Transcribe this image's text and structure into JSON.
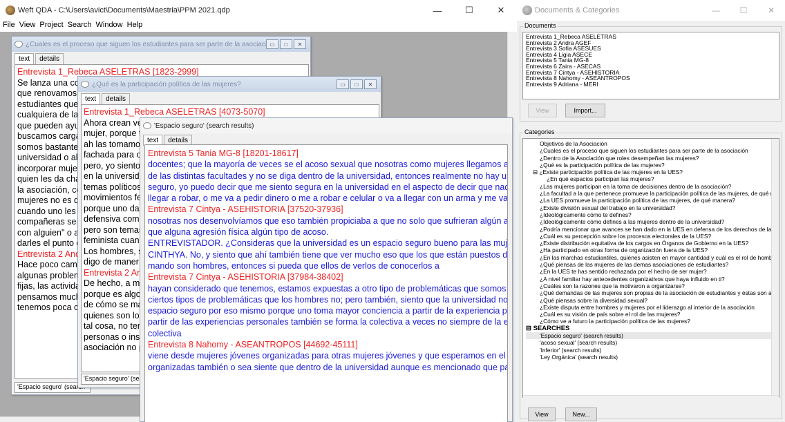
{
  "app": {
    "title": "Weft QDA - C:\\Users\\avict\\Documents\\Maestria\\PPM 2021.qdp",
    "menu": [
      "File",
      "View",
      "Project",
      "Search",
      "Window",
      "Help"
    ],
    "win_min": "—",
    "win_max": "☐",
    "win_close": "✕"
  },
  "windows": {
    "w1": {
      "title": "¿Cuales es el proceso que siguen los estudiantes para ser parte de la asociación",
      "tab_text": "text",
      "tab_details": "details",
      "lines": [
        {
          "c": "red",
          "t": "Entrevista 1_Rebeca ASELETRAS [1823-2999]"
        },
        {
          "c": "",
          "t": "Se lanza una co"
        },
        {
          "c": "",
          "t": "que renovamos"
        },
        {
          "c": "",
          "t": "estudiantes que"
        },
        {
          "c": "",
          "t": "cualquiera de las"
        },
        {
          "c": "",
          "t": "que pueden ayu"
        },
        {
          "c": "",
          "t": "buscamos carga"
        },
        {
          "c": "",
          "t": "somos bastante"
        },
        {
          "c": "",
          "t": "universidad o alg"
        },
        {
          "c": "",
          "t": "incorporar mujer"
        },
        {
          "c": "",
          "t": "quien les da cha"
        },
        {
          "c": "",
          "t": "la asociación, co"
        },
        {
          "c": "",
          "t": "mujeres no es q"
        },
        {
          "c": "",
          "t": "cuando uno les"
        },
        {
          "c": "",
          "t": "compañeras se"
        },
        {
          "c": "",
          "t": "con alguien\" o al"
        },
        {
          "c": "",
          "t": "darles el punto d"
        },
        {
          "c": "",
          "t": " "
        },
        {
          "c": "",
          "t": " "
        },
        {
          "c": "red",
          "t": "Entrevista 2 And"
        },
        {
          "c": "",
          "t": "Hace poco camb"
        },
        {
          "c": "",
          "t": "algunas problem"
        },
        {
          "c": "",
          "t": "fijas, las activida"
        },
        {
          "c": "",
          "t": "pensamos much"
        },
        {
          "c": "",
          "t": "tenemos poca c"
        }
      ],
      "status": "'Espacio seguro' (search"
    },
    "w2": {
      "title": "¿Qué es la participación política de las mujeres?",
      "tab_text": "text",
      "tab_details": "details",
      "lines": [
        {
          "c": "red",
          "t": "Entrevista 1_Rebeca ASELETRAS [4073-5070]"
        },
        {
          "c": "",
          "t": "Ahora crean ve"
        },
        {
          "c": "",
          "t": "mujer, porque t"
        },
        {
          "c": "",
          "t": "ah las tomamo"
        },
        {
          "c": "",
          "t": "fachada para c"
        },
        {
          "c": "",
          "t": "pero, yo siento"
        },
        {
          "c": "",
          "t": "en la universida"
        },
        {
          "c": "",
          "t": "temas políticos"
        },
        {
          "c": "",
          "t": "movimientos fe"
        },
        {
          "c": "",
          "t": "porque uno da"
        },
        {
          "c": "",
          "t": "defensiva com"
        },
        {
          "c": "",
          "t": "pero son temas"
        },
        {
          "c": "",
          "t": "feminista cuan"
        },
        {
          "c": "",
          "t": "Los hombres, s"
        },
        {
          "c": "",
          "t": "digo de maner"
        },
        {
          "c": "",
          "t": " "
        },
        {
          "c": "",
          "t": " "
        },
        {
          "c": "red",
          "t": "Entrevista 2 Ar"
        },
        {
          "c": "",
          "t": "De hecho, a m"
        },
        {
          "c": "",
          "t": "porque es algo"
        },
        {
          "c": "",
          "t": "de cómo se ma"
        },
        {
          "c": "",
          "t": "quienes son lo"
        },
        {
          "c": "",
          "t": "tal cosa, no ter"
        },
        {
          "c": "",
          "t": "personas o ins"
        },
        {
          "c": "",
          "t": "asociación no p"
        }
      ],
      "status": "'Espacio seguro' (sear"
    },
    "w3": {
      "title": "'Espacio seguro' (search results)",
      "tab_text": "text",
      "tab_details": "details",
      "lines": [
        {
          "c": "red",
          "t": "Entrevista 5 Tania MG-8 [18201-18617]"
        },
        {
          "c": "blue",
          "t": "docentes; que la mayoría de veces se el acoso sexual que nosotras como mujeres llegamos a sufrir"
        },
        {
          "c": "blue",
          "t": "de las distintas facultades y no se diga dentro de la universidad, entonces realmente no hay un esp"
        },
        {
          "c": "blue",
          "t": "seguro, yo puedo decir que me siento segura en la universidad en el aspecto de decir que nadie me"
        },
        {
          "c": "blue",
          "t": "llegar a robar, o me va a pedir dinero o me a robar e celular o va a llegar con un arma y me va a apur"
        },
        {
          "c": "",
          "t": " "
        },
        {
          "c": "",
          "t": " "
        },
        {
          "c": "red",
          "t": "Entrevista 7 Cintya - ASEHISTORIA [37520-37936]"
        },
        {
          "c": "blue",
          "t": "nosotras nos desenvolvíamos que eso también propiciaba a que no solo que sufrieran algún asalto"
        },
        {
          "c": "blue",
          "t": "que alguna agresión física algún tipo de acoso."
        },
        {
          "c": "",
          "t": " "
        },
        {
          "c": "blue",
          "t": "ENTREVISTADOR. ¿Consideras que la universidad es un espacio seguro bueno para las mujeres?"
        },
        {
          "c": "blue",
          "t": "CINTHYA. No, y siento que ahí también tiene que ver mucho eso que los que están puestos de poc"
        },
        {
          "c": "blue",
          "t": "mando son hombres, entonces si pueda que ellos de verlos de conocerlos a"
        },
        {
          "c": "",
          "t": " "
        },
        {
          "c": "red",
          "t": "Entrevista 7 Cintya - ASEHISTORIA [37984-38402]"
        },
        {
          "c": "blue",
          "t": "hayan considerado que tenemos, estamos expuestas a otro tipo de problemáticas que somos vulne"
        },
        {
          "c": "blue",
          "t": "ciertos tipos de problemáticas que los hombres no; pero también, siento que la universidad no es u"
        },
        {
          "c": "blue",
          "t": "espacio seguro por eso mismo porque uno toma mayor conciencia a partir de la experiencia person"
        },
        {
          "c": "blue",
          "t": "partir de las experiencias personales también se forma la colectiva a veces no siempre de la experie"
        },
        {
          "c": "blue",
          "t": "colectiva"
        },
        {
          "c": "",
          "t": " "
        },
        {
          "c": "",
          "t": " "
        },
        {
          "c": "red",
          "t": "Entrevista 8 Nahomy - ASEANTROPOS [44692-45111]"
        },
        {
          "c": "blue",
          "t": "viene desde mujeres jóvenes organizadas para otras mujeres jóvenes y que esperamos en el futuro"
        },
        {
          "c": "blue",
          "t": "organizadas también o sea siente que dentro de la universidad aunque es mencionado que para m"
        }
      ]
    }
  },
  "panel": {
    "title": "Documents & Categories",
    "documents_label": "Documents",
    "documents": [
      "Entrevista 1_Rebeca ASELETRAS",
      "Entrevista 2 Andra AGEF",
      "Entrevista 3 Sofia ASESUES",
      "Entrevista 4 Ligia ASECE",
      "Entrevista 5 Tania MG-8",
      "Entrevista 6 Zaira - ASECAS",
      "Entrevista 7 Cintya - ASEHISTORIA",
      "Entrevista 8 Nahomy - ASEANTROPOS",
      "Entrevista 9 Adriana - MERI"
    ],
    "view_label": "View",
    "import_label": "Import...",
    "categories_label": "Categories",
    "categories": [
      {
        "t": "Objetivos de la Asociación",
        "i": 0
      },
      {
        "t": "¿Cuales es el proceso que siguen los estudiantes para ser parte de la asociación",
        "i": 0
      },
      {
        "t": "¿Dentro de la Asociación que roles desempeñan las mujeres?",
        "i": 0
      },
      {
        "t": "¿Qué es la participación política de las mujeres?",
        "i": 0
      },
      {
        "t": "⊟ ¿Existe participación política de las mujeres en la UES?",
        "i": -1
      },
      {
        "t": "¿En qué espacios participan las mujeres?",
        "i": 1
      },
      {
        "t": "¿Las mujeres participan en la toma de decisiones dentro de la asociación?",
        "i": 0
      },
      {
        "t": "¿La facultad a la que pertenece promueve la participación política de las mujeres, de qué maner",
        "i": 0
      },
      {
        "t": "¿La UES promueve la participación política de las mujeres, de qué manera?",
        "i": 0
      },
      {
        "t": "¿Existe división sexual del trabajo en la universidad?",
        "i": 0
      },
      {
        "t": "¿Ideológicamente cómo te defines?",
        "i": 0
      },
      {
        "t": "¿Ideológicamente cómo defines a las mujeres dentro de la universidad?",
        "i": 0
      },
      {
        "t": "¿Podría mencionar que avances se han dado en la UES en defensa de los derechos de las muje",
        "i": 0
      },
      {
        "t": "¿Cuál es su percepción sobre los procesos electorales de la UES?",
        "i": 0
      },
      {
        "t": "¿Existe distribución equitativa de los cargos en Órganos de Gobierno en la UES?",
        "i": 0
      },
      {
        "t": "¿Ha participado en otras forma de organización fuera de la UES?",
        "i": 0
      },
      {
        "t": "¿En las marchas estudiantiles, quiénes asisten en mayor cantidad y cuál es el rol de hombres y m",
        "i": 0
      },
      {
        "t": "¿Qué piensas de las mujeres de las demas asociaciones de estudiantes?",
        "i": 0
      },
      {
        "t": "¿En la UES te has sentido rechazada por el hecho de ser mujer?",
        "i": 0
      },
      {
        "t": "¿A nivel familiar hay antecedentes organizativos que haya influido en ti?",
        "i": 0
      },
      {
        "t": "¿Cuáles son la razones que la motivaron a organizarse?",
        "i": 0
      },
      {
        "t": "¿Qué demandas de las mujeres son propias de la asociación de estudiantes y éstas son apoyada",
        "i": 0
      },
      {
        "t": "¿Qué piensas sobre la diversidad sexual?",
        "i": 0
      },
      {
        "t": "¿Existe disputa entre hombres y mujeres  por el liderazgo al interior de la asociación",
        "i": 0
      },
      {
        "t": "¿Cuál es su visión de país sobre el rol de las mujeres?",
        "i": 0
      },
      {
        "t": "¿Cómo ve a futuro la participación política de las mujeres?",
        "i": 0
      }
    ],
    "searches_label": "⊟  SEARCHES",
    "searches": [
      "'Espacio seguro' (search results)",
      "'acoso sexual' (search results)",
      "'Inferior' (search results)",
      "'Ley Orgánica' (search results)"
    ],
    "view2_label": "View",
    "new_label": "New...",
    "win_min": "—",
    "win_max": "☐",
    "win_close": "✕"
  }
}
